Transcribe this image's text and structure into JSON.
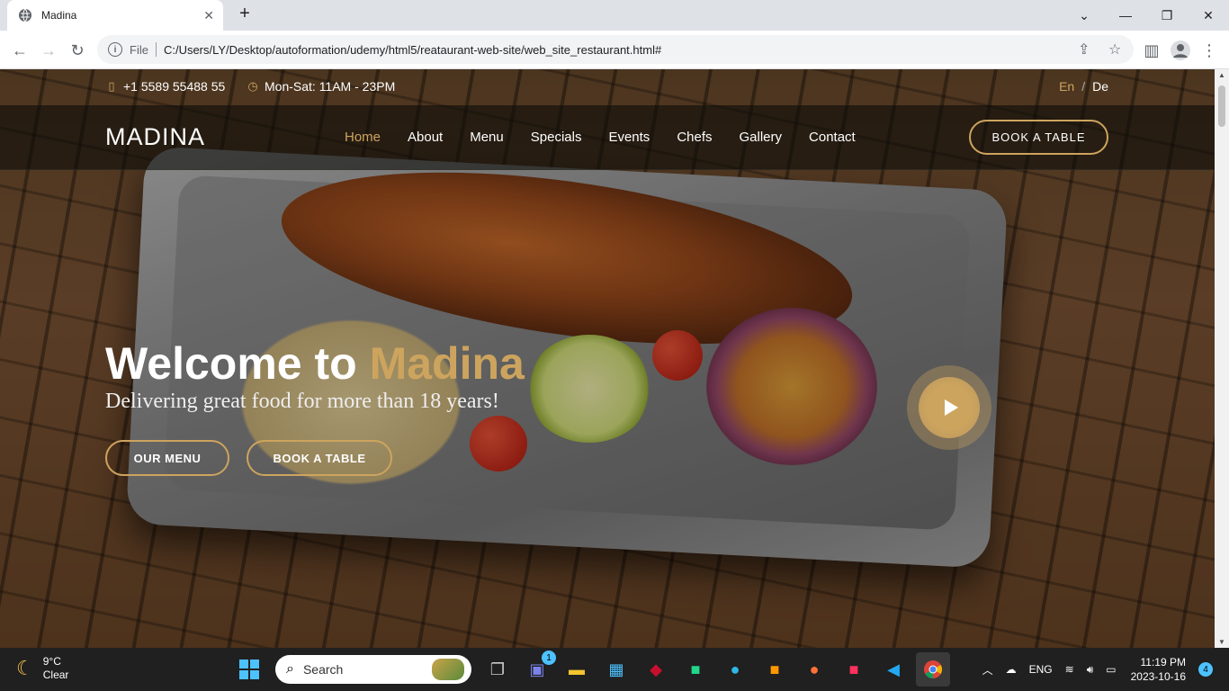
{
  "browser": {
    "tab_title": "Madina",
    "url_scheme": "File",
    "url": "C:/Users/LY/Desktop/autoformation/udemy/html5/reataurant-web-site/web_site_restaurant.html#"
  },
  "topbar": {
    "phone": "+1 5589 55488 55",
    "hours": "Mon-Sat: 11AM - 23PM",
    "lang_en": "En",
    "lang_sep": "/",
    "lang_de": "De"
  },
  "header": {
    "logo": "MADINA",
    "nav": [
      "Home",
      "About",
      "Menu",
      "Specials",
      "Events",
      "Chefs",
      "Gallery",
      "Contact"
    ],
    "book_button": "BOOK A TABLE"
  },
  "hero": {
    "title_plain": "Welcome to ",
    "title_accent": "Madina",
    "subtitle": "Delivering great food for more than 18 years!",
    "btn_menu": "OUR MENU",
    "btn_book": "BOOK A TABLE"
  },
  "colors": {
    "accent": "#cda45e"
  },
  "taskbar": {
    "temp": "9°C",
    "condition": "Clear",
    "search_placeholder": "Search",
    "teams_badge": "1",
    "lang": "ENG",
    "time": "11:19 PM",
    "date": "2023-10-16",
    "notif_count": "4"
  }
}
